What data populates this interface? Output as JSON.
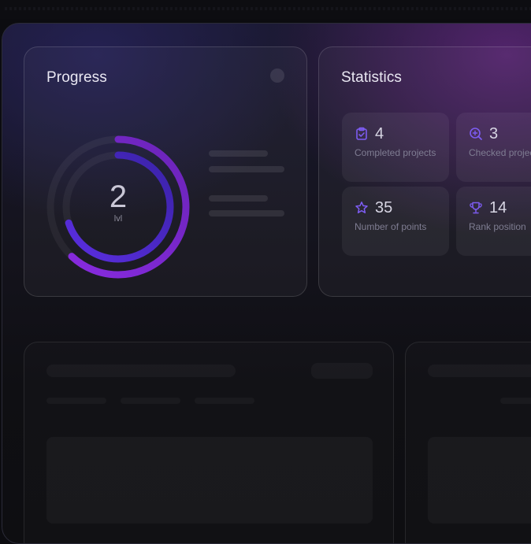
{
  "progress": {
    "title": "Progress",
    "level_value": "2",
    "level_label": "lvl",
    "outer_ring_fraction": 0.62,
    "inner_ring_fraction": 0.7
  },
  "statistics": {
    "title": "Statistics",
    "items": [
      {
        "value": "4",
        "label": "Completed projects",
        "icon": "clipboard-check-icon"
      },
      {
        "value": "3",
        "label": "Checked projects",
        "icon": "search-plus-icon"
      },
      {
        "value": "35",
        "label": "Number of points",
        "icon": "star-icon"
      },
      {
        "value": "14",
        "label": "Rank position",
        "icon": "trophy-icon"
      }
    ]
  },
  "colors": {
    "accent_purple": "#7b2fd6",
    "accent_indigo": "#4a2bd0",
    "icon_violet": "#7d5cf2"
  }
}
